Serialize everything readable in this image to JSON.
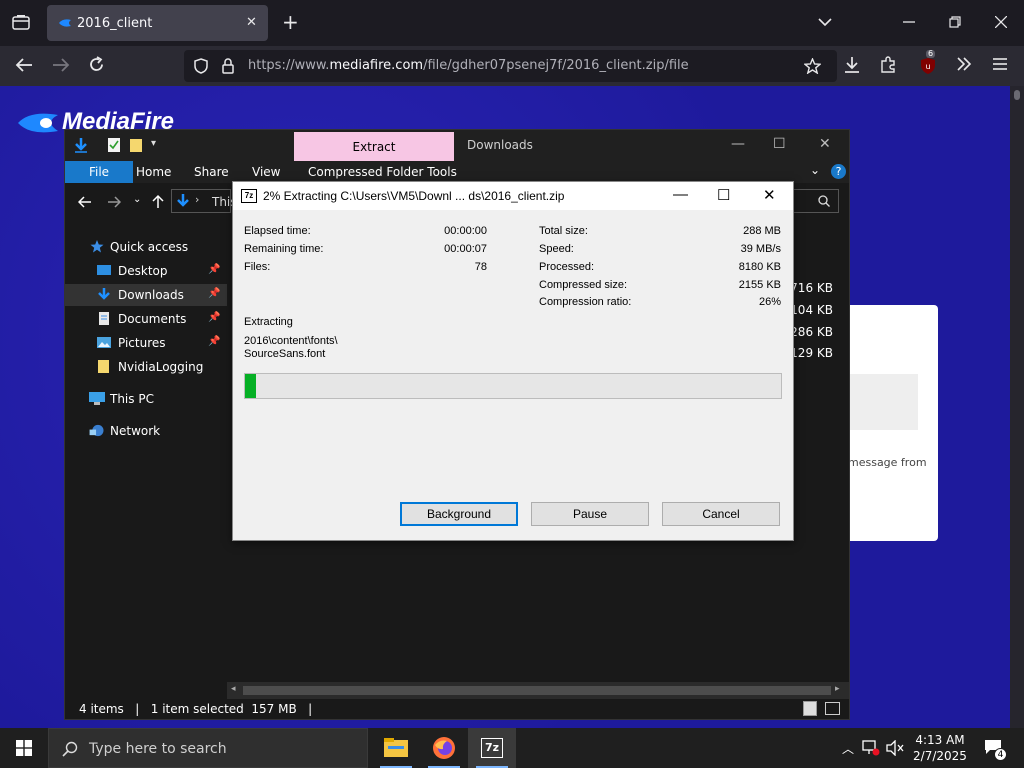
{
  "browser": {
    "tab_title": "2016_client",
    "tab_close": "✕",
    "new_tab": "+",
    "url_prefix": "https://www.",
    "url_host": "mediafire.com",
    "url_path": "/file/gdher07psenej7f/2016_client.zip/file",
    "extensions_badge": "6"
  },
  "mediafire": {
    "logo_text": "MediaFire",
    "card_text": "message from"
  },
  "explorer": {
    "tab_extract": "Extract",
    "tab_downloads": "Downloads",
    "ribbon": {
      "file": "File",
      "home": "Home",
      "share": "Share",
      "view": "View",
      "compressed_tools": "Compressed Folder Tools"
    },
    "address_text": "This",
    "nav": [
      {
        "label": "Quick access",
        "icon": "star-icon"
      },
      {
        "label": "Desktop",
        "icon": "desktop-icon"
      },
      {
        "label": "Downloads",
        "icon": "download-icon"
      },
      {
        "label": "Documents",
        "icon": "documents-icon"
      },
      {
        "label": "Pictures",
        "icon": "pictures-icon"
      },
      {
        "label": "NvidiaLogging",
        "icon": "folder-icon"
      },
      {
        "label": "This PC",
        "icon": "computer-icon"
      },
      {
        "label": "Network",
        "icon": "network-icon"
      }
    ],
    "file_sizes": [
      ",716 KB",
      ",104 KB",
      "286 KB",
      ",129 KB"
    ],
    "status": "4 items   |   1 item selected  157 MB   |"
  },
  "zip": {
    "title": "2% Extracting C:\\Users\\VM5\\Downl ... ds\\2016_client.zip",
    "left": {
      "elapsed_label": "Elapsed time:",
      "elapsed_value": "00:00:00",
      "remaining_label": "Remaining time:",
      "remaining_value": "00:00:07",
      "files_label": "Files:",
      "files_value": "78"
    },
    "right": {
      "total_label": "Total size:",
      "total_value": "288 MB",
      "speed_label": "Speed:",
      "speed_value": "39 MB/s",
      "processed_label": "Processed:",
      "processed_value": "8180 KB",
      "compressed_label": "Compressed size:",
      "compressed_value": "2155 KB",
      "ratio_label": "Compression ratio:",
      "ratio_value": "26%"
    },
    "extracting_label": "Extracting",
    "path_line1": "2016\\content\\fonts\\",
    "path_line2": "SourceSans.font",
    "progress_fraction": 0.02,
    "buttons": {
      "background": "Background",
      "pause": "Pause",
      "cancel": "Cancel"
    }
  },
  "taskbar": {
    "search_placeholder": "Type here to search",
    "time": "4:13 AM",
    "date": "2/7/2025",
    "notification_count": "4",
    "app_7zip_label": "7z"
  }
}
